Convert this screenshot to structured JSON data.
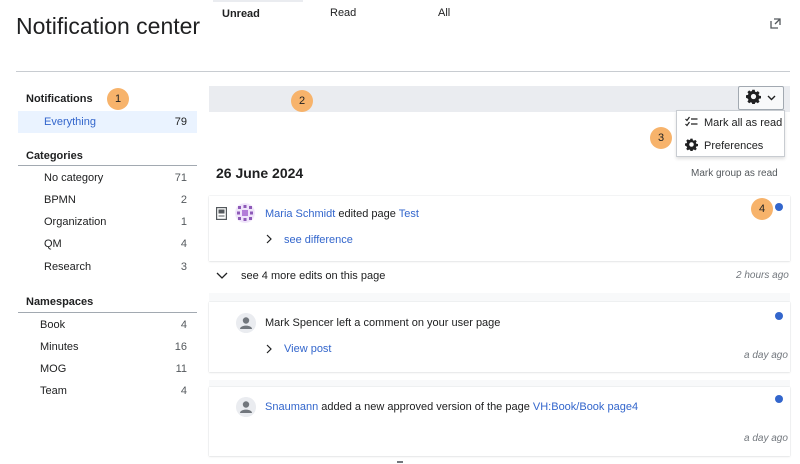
{
  "page": {
    "title": "Notification center"
  },
  "badges": {
    "b1": "1",
    "b2": "2",
    "b3": "3",
    "b4": "4"
  },
  "sidebar": {
    "notifications_heading": "Notifications",
    "everything": {
      "label": "Everything",
      "count": "79"
    },
    "categories_heading": "Categories",
    "categories": [
      {
        "label": "No category",
        "count": "71"
      },
      {
        "label": "BPMN",
        "count": "2"
      },
      {
        "label": "Organization",
        "count": "1"
      },
      {
        "label": "QM",
        "count": "4"
      },
      {
        "label": "Research",
        "count": "3"
      }
    ],
    "namespaces_heading": "Namespaces",
    "namespaces": [
      {
        "label": "Book",
        "count": "4"
      },
      {
        "label": "Minutes",
        "count": "16"
      },
      {
        "label": "MOG",
        "count": "11"
      },
      {
        "label": "Team",
        "count": "4"
      }
    ]
  },
  "tabs": {
    "unread": "Unread",
    "read": "Read",
    "all": "All"
  },
  "menu": {
    "mark_all": "Mark all as read",
    "preferences": "Preferences"
  },
  "group": {
    "date": "26 June 2024",
    "mark_group": "Mark group as read"
  },
  "notifications": [
    {
      "user": "Maria Schmidt",
      "action": "edited page",
      "page": "Test",
      "sub_link": "see difference",
      "more": "see 4 more edits on this page",
      "time": "2 hours ago"
    },
    {
      "user": "Mark Spencer",
      "action": "left a comment on your user page",
      "sub_link": "View post",
      "time": "a day ago"
    },
    {
      "user": "Snaumann",
      "action": "added a new approved version of the page",
      "page": "VH:Book/Book page4",
      "time": "a day ago"
    }
  ],
  "colors": {
    "accent": "#3366cc",
    "badge": "#f7b36b",
    "active_bg": "#eaf3ff"
  },
  "icons": [
    "expand-icon",
    "gear-icon",
    "chevron-down-icon",
    "checklist-icon",
    "book-icon",
    "chevron-right-icon",
    "user-icon"
  ]
}
